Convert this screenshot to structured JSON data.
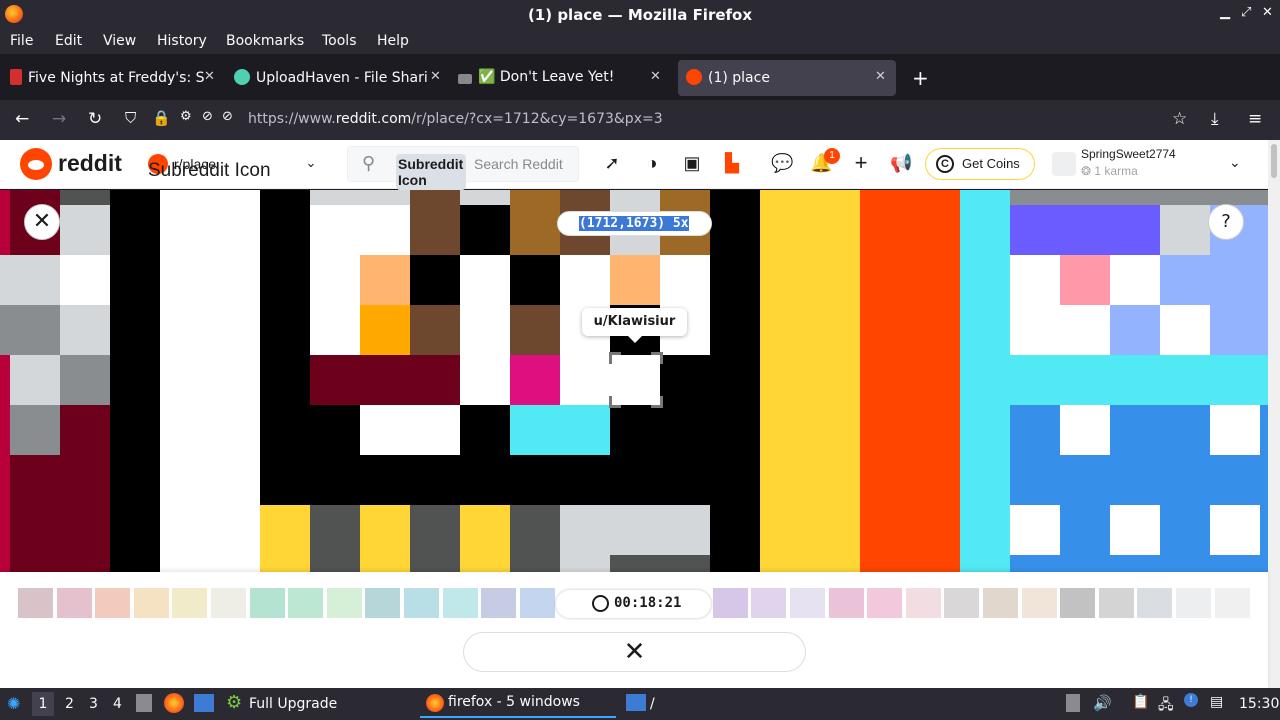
{
  "window": {
    "title": "(1) place — Mozilla Firefox"
  },
  "menu": [
    "File",
    "Edit",
    "View",
    "History",
    "Bookmarks",
    "Tools",
    "Help"
  ],
  "tabs": [
    {
      "label": "Five Nights at Freddy's: S",
      "color": "#d32f2f",
      "active": false
    },
    {
      "label": "UploadHaven - File Shari",
      "color": "#4fd1b1",
      "active": false
    },
    {
      "label": "✅ Don't Leave Yet!",
      "color": "#888888",
      "active": false
    },
    {
      "label": "(1) place",
      "color": "#ff4500",
      "active": true
    }
  ],
  "url": {
    "prefix": "https://www.",
    "host": "reddit.com",
    "path": "/r/place/?cx=1712&cy=1673&px=3"
  },
  "reddit": {
    "logo_text": "reddit",
    "subreddit": "r/place",
    "subreddit_icon_alt": "Subreddit Icon",
    "search_chip": "Subreddit Icon",
    "search_placeholder": "Search Reddit",
    "notif_count": "1",
    "coins_label": "Get Coins",
    "username": "SpringSweet2774",
    "karma": "1 karma"
  },
  "place": {
    "coords": "(1712,1673) 5x",
    "hover_user": "u/Klawisiur",
    "timer": "00:18:21",
    "palette": [
      "#d8c3c9",
      "#e5c0cd",
      "#f3cbbe",
      "#f5e2c2",
      "#f2ebc9",
      "#eeeee7",
      "#b4e3d2",
      "#bce8d3",
      "#d5f0d6",
      "#b7d6da",
      "#b8dfe6",
      "#c0e8ea",
      "#c5cce3",
      "#c4d6ef",
      "#ffffff",
      "#ffffff",
      "#ffffff",
      "#ffffff",
      "#d6c6e8",
      "#dfd3ee",
      "#e6e2f1",
      "#ebc3d9",
      "#f2c9dc",
      "#f2dde2",
      "#d9d7d7",
      "#e2d7cd",
      "#f1e5da",
      "#c2c2c2",
      "#d4d4d4",
      "#dadde1",
      "#eceef0",
      "#f0f0f0"
    ]
  },
  "taskbar": {
    "workspaces": [
      "1",
      "2",
      "3",
      "4"
    ],
    "upgrade": "Full Upgrade",
    "firefox": "firefox - 5 windows",
    "folder": "/",
    "clock": "15:30"
  }
}
